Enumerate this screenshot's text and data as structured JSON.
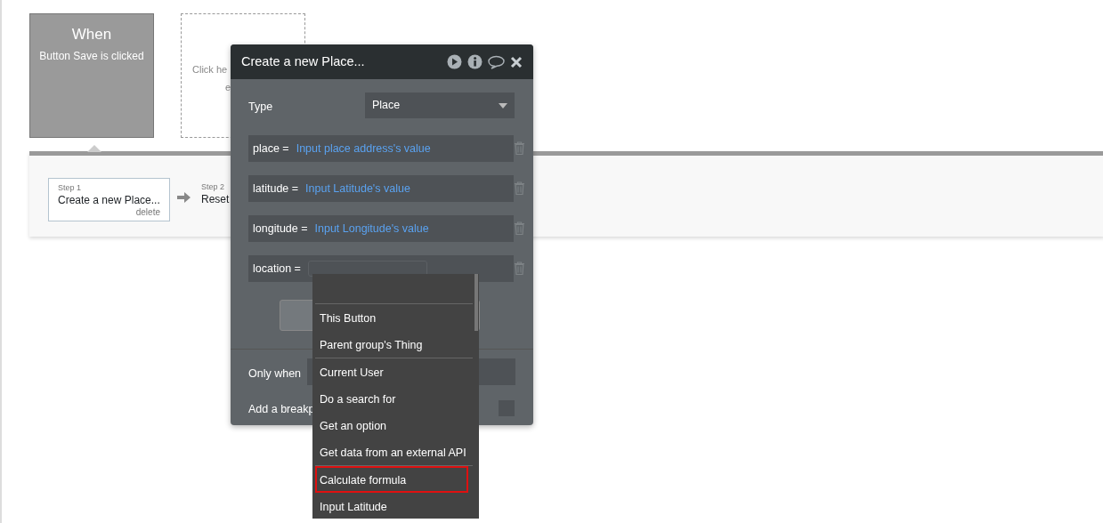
{
  "trigger": {
    "title": "When",
    "event": "Button Save is clicked"
  },
  "placeholder_box": {
    "lines": [
      "Click he",
      "e"
    ]
  },
  "steps": [
    {
      "step": "Step 1",
      "title": "Create a new Place...",
      "delete": "delete",
      "selected": true
    },
    {
      "step": "Step 2",
      "title": "Reset",
      "selected": false
    }
  ],
  "popup": {
    "title": "Create a new Place...",
    "type": {
      "label": "Type",
      "value": "Place"
    },
    "fields": [
      {
        "label": "place =",
        "value": "Input place address's value"
      },
      {
        "label": "latitude =",
        "value": "Input Latitude's value"
      },
      {
        "label": "longitude =",
        "value": "Input Longitude's value"
      },
      {
        "label": "location ="
      }
    ],
    "only_when": {
      "label": "Only when"
    },
    "breakpoint": {
      "label": "Add a breakp",
      "checked": false
    }
  },
  "dropdown": {
    "items": [
      {
        "label": "This Button",
        "selected": false,
        "divider_after": false
      },
      {
        "label": "Parent group's Thing",
        "selected": false,
        "divider_after": true
      },
      {
        "label": "Current User",
        "selected": false,
        "divider_after": false
      },
      {
        "label": "Do a search for",
        "selected": false,
        "divider_after": false
      },
      {
        "label": "Get an option",
        "selected": false,
        "divider_after": false
      },
      {
        "label": "Get data from an external API",
        "selected": false,
        "divider_after": true
      },
      {
        "label": "Calculate formula",
        "selected": true,
        "divider_after": false
      },
      {
        "label": "Input Latitude",
        "selected": false,
        "divider_after": false
      }
    ]
  }
}
